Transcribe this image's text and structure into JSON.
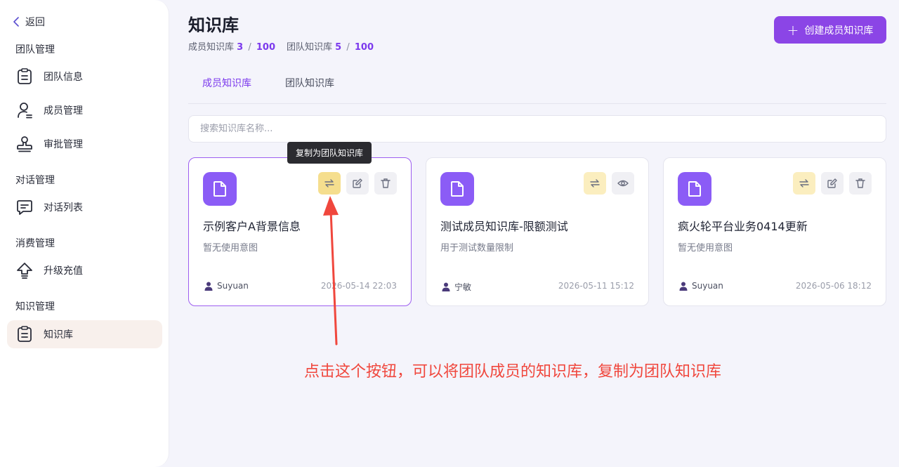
{
  "sidebar": {
    "back_label": "返回",
    "groups": [
      {
        "title": "团队管理",
        "items": [
          {
            "label": "团队信息",
            "icon": "clipboard-icon"
          },
          {
            "label": "成员管理",
            "icon": "user-icon"
          },
          {
            "label": "审批管理",
            "icon": "stamp-icon"
          }
        ]
      },
      {
        "title": "对话管理",
        "items": [
          {
            "label": "对话列表",
            "icon": "chat-icon"
          }
        ]
      },
      {
        "title": "消费管理",
        "items": [
          {
            "label": "升级充值",
            "icon": "upgrade-icon"
          }
        ]
      },
      {
        "title": "知识管理",
        "items": [
          {
            "label": "知识库",
            "icon": "clipboard-icon",
            "active": true
          }
        ]
      }
    ]
  },
  "header": {
    "title": "知识库",
    "member_quota_label": "成员知识库",
    "member_used": "3",
    "member_total": "100",
    "team_quota_label": "团队知识库",
    "team_used": "5",
    "team_total": "100",
    "slash": "/",
    "create_label": "创建成员知识库"
  },
  "tabs": [
    {
      "label": "成员知识库",
      "active": true
    },
    {
      "label": "团队知识库",
      "active": false
    }
  ],
  "search": {
    "placeholder": "搜索知识库名称..."
  },
  "cards": [
    {
      "title": "示例客户A背景信息",
      "desc": "暂无使用意图",
      "owner": "Suyuan",
      "date": "2026-05-14 22:03",
      "actions": [
        "copy-icon",
        "edit-icon",
        "trash-icon"
      ]
    },
    {
      "title": "测试成员知识库-限额测试",
      "desc": "用于测试数量限制",
      "owner": "宁敏",
      "date": "2026-05-11 15:12",
      "actions": [
        "copy-icon",
        "eye-icon"
      ]
    },
    {
      "title": "疯火轮平台业务0414更新",
      "desc": "暂无使用意图",
      "owner": "Suyuan",
      "date": "2026-05-06 18:12",
      "actions": [
        "copy-icon",
        "edit-icon",
        "trash-icon"
      ]
    }
  ],
  "tooltip": "复制为团队知识库",
  "annotation": "点击这个按钮，可以将团队成员的知识库，复制为团队知识库",
  "colors": {
    "accent": "#8b45e6",
    "annotation": "#f0473d",
    "copy_button": "#fbeebf"
  }
}
